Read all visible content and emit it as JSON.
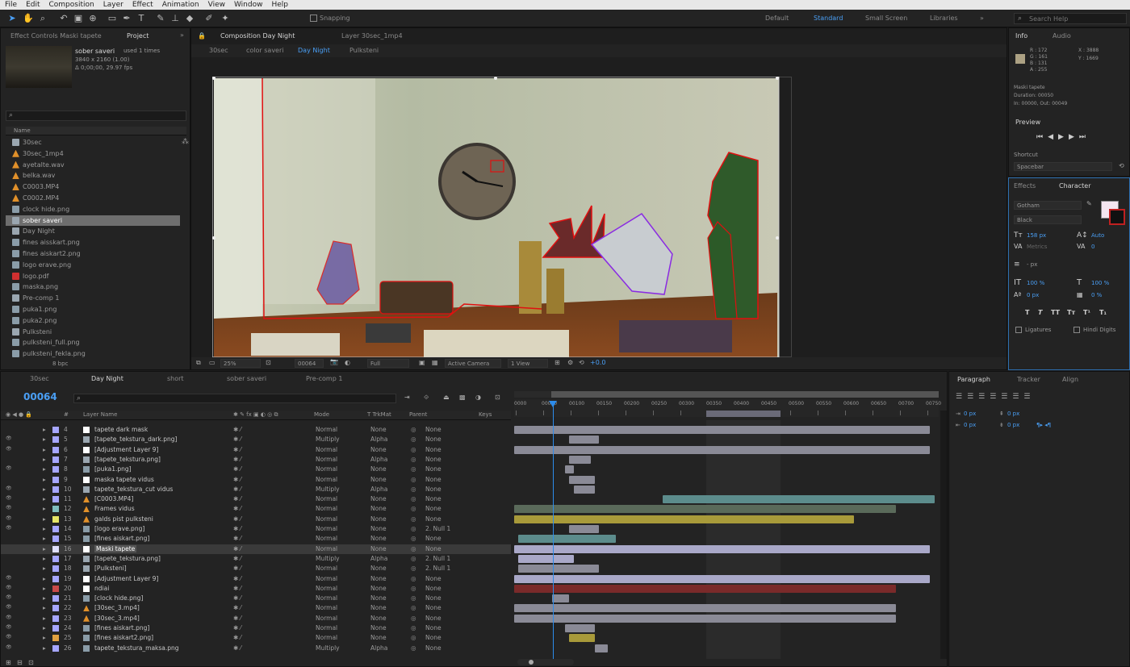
{
  "menu": [
    "File",
    "Edit",
    "Composition",
    "Layer",
    "Effect",
    "Animation",
    "View",
    "Window",
    "Help"
  ],
  "toolbar": {
    "snapping_label": "Snapping",
    "workspaces": [
      "Default",
      "Standard",
      "Small Screen",
      "Libraries"
    ],
    "search_placeholder": "Search Help"
  },
  "project": {
    "tabs": [
      "Effect Controls Maski tapete",
      "Project"
    ],
    "selected_item": {
      "name": "sober saveri",
      "used": "used 1 times",
      "size": "3840 x 2160 (1.00)",
      "duration": "Δ 0;00;00, 29.97 fps"
    },
    "search_placeholder": "",
    "column_header": "Name",
    "items": [
      {
        "name": "30sec",
        "type": "comp"
      },
      {
        "name": "30sec_1mp4",
        "type": "cone"
      },
      {
        "name": "ayetalte.wav",
        "type": "cone"
      },
      {
        "name": "belka.wav",
        "type": "cone"
      },
      {
        "name": "C0003.MP4",
        "type": "cone"
      },
      {
        "name": "C0002.MP4",
        "type": "cone"
      },
      {
        "name": "clock hide.png",
        "type": "img"
      },
      {
        "name": "sober saveri",
        "type": "comp",
        "selected": true
      },
      {
        "name": "Day Night",
        "type": "comp"
      },
      {
        "name": "fines aisskart.png",
        "type": "img"
      },
      {
        "name": "fines aiskart2.png",
        "type": "img"
      },
      {
        "name": "logo erave.png",
        "type": "img"
      },
      {
        "name": "logo.pdf",
        "type": "pdf"
      },
      {
        "name": "maska.png",
        "type": "img"
      },
      {
        "name": "Pre-comp 1",
        "type": "comp"
      },
      {
        "name": "puka1.png",
        "type": "img"
      },
      {
        "name": "puka2.png",
        "type": "img"
      },
      {
        "name": "Pulksteni",
        "type": "comp"
      },
      {
        "name": "pulksteni_full.png",
        "type": "img"
      },
      {
        "name": "pulksteni_fekla.png",
        "type": "img"
      }
    ],
    "footer_bpc": "8 bpc"
  },
  "composition": {
    "tabs": [
      "Composition Day Night",
      "Layer 30sec_1mp4"
    ],
    "breadcrumb": [
      "30sec",
      "color saveri",
      "Day Night",
      "Pulksteni"
    ],
    "zoom": "25%",
    "timecode": "00064",
    "resolution": "Full",
    "camera": "Active Camera",
    "views": "1 View",
    "exposure": "+0.0"
  },
  "info": {
    "tabs": [
      "Info",
      "Audio"
    ],
    "rgba": [
      "R : 172",
      "G : 161",
      "B : 131",
      "A : 255"
    ],
    "xy": [
      "X : 3888",
      "Y : 1669"
    ],
    "layer_name": "Maski tapete",
    "duration": "Duration: 00050",
    "inout": "In: 00000, Out: 00049",
    "preview_label": "Preview",
    "shortcut_label": "Shortcut",
    "shortcut_value": "Spacebar"
  },
  "character": {
    "tabs": [
      "Effects",
      "Character"
    ],
    "font": "Gotham",
    "style": "Black",
    "size": "158 px",
    "leading": "Auto",
    "tracking": "0",
    "kerning": "Metrics",
    "stroke": "- px",
    "vscale": "100 %",
    "hscale": "100 %",
    "baseline": "0 px",
    "tsume": "0 %",
    "ligatures": "Ligatures",
    "hindi": "Hindi Digits",
    "style_buttons": [
      "T",
      "T",
      "TT",
      "Tт",
      "T¹",
      "T₁"
    ]
  },
  "paragraph": {
    "tabs": [
      "Paragraph",
      "Tracker",
      "Align"
    ],
    "indent_values": [
      "0 px",
      "0 px",
      "0 px",
      "0 px",
      "0 px"
    ]
  },
  "timeline": {
    "tabs": [
      "30sec",
      "Day Night",
      "short",
      "sober saveri",
      "Pre-comp 1"
    ],
    "timecode": "00064",
    "search_placeholder": "",
    "headers": {
      "num": "#",
      "name": "Layer Name",
      "mode": "Mode",
      "trkmat": "T TrkMat",
      "parent": "Parent",
      "keys": "Keys"
    },
    "ruler": [
      "0000",
      "00050",
      "00100",
      "00150",
      "00200",
      "00250",
      "00300",
      "00350",
      "00400",
      "00450",
      "00500",
      "00550",
      "00600",
      "00650",
      "00700",
      "00750"
    ],
    "layers": [
      {
        "n": "4",
        "color": "#a6a6ff",
        "icon": "solid",
        "name": "tapete dark mask",
        "mode": "Normal",
        "trk": "None",
        "parent": "None",
        "eye": false
      },
      {
        "n": "5",
        "color": "#a6a6ff",
        "icon": "comp",
        "name": "[tapete_tekstura_dark.png]",
        "mode": "Multiply",
        "trk": "Alpha",
        "parent": "None",
        "eye": true
      },
      {
        "n": "6",
        "color": "#a6a6ff",
        "icon": "solid",
        "name": "[Adjustment Layer 9]",
        "mode": "Normal",
        "trk": "None",
        "parent": "None",
        "eye": true
      },
      {
        "n": "7",
        "color": "#a6a6ff",
        "icon": "comp",
        "name": "[tapete_tekstura.png]",
        "mode": "Normal",
        "trk": "Alpha",
        "parent": "None",
        "eye": false
      },
      {
        "n": "8",
        "color": "#a6a6ff",
        "icon": "img",
        "name": "[puka1.png]",
        "mode": "Normal",
        "trk": "None",
        "parent": "None",
        "eye": true
      },
      {
        "n": "9",
        "color": "#a6a6ff",
        "icon": "solid",
        "name": "maska tapete vidus",
        "mode": "Normal",
        "trk": "None",
        "parent": "None",
        "eye": false
      },
      {
        "n": "10",
        "color": "#a6a6ff",
        "icon": "comp",
        "name": "tapete_tekstura_cut vidus",
        "mode": "Multiply",
        "trk": "Alpha",
        "parent": "None",
        "eye": true
      },
      {
        "n": "11",
        "color": "#a6a6ff",
        "icon": "cone",
        "name": "[C0003.MP4]",
        "mode": "Normal",
        "trk": "None",
        "parent": "None",
        "eye": true
      },
      {
        "n": "12",
        "color": "#7fbdbd",
        "icon": "cone",
        "name": "Frames vidus",
        "mode": "Normal",
        "trk": "None",
        "parent": "None",
        "eye": true
      },
      {
        "n": "13",
        "color": "#e5e566",
        "icon": "cone",
        "name": "galds pist pulksteni",
        "mode": "Normal",
        "trk": "None",
        "parent": "None",
        "eye": true
      },
      {
        "n": "14",
        "color": "#a6a6ff",
        "icon": "img",
        "name": "[logo erave.png]",
        "mode": "Normal",
        "trk": "None",
        "parent": "2. Null 1",
        "eye": true
      },
      {
        "n": "15",
        "color": "#a6a6ff",
        "icon": "img",
        "name": "[fines aiskart.png]",
        "mode": "Normal",
        "trk": "None",
        "parent": "None",
        "eye": false
      },
      {
        "n": "16",
        "color": "#e0e0ff",
        "icon": "solid",
        "name": "Maski tapete",
        "mode": "Normal",
        "trk": "None",
        "parent": "None",
        "eye": false,
        "selected": true
      },
      {
        "n": "17",
        "color": "#a6a6ff",
        "icon": "comp",
        "name": "[tapete_tekstura.png]",
        "mode": "Multiply",
        "trk": "Alpha",
        "parent": "2. Null 1",
        "eye": false
      },
      {
        "n": "18",
        "color": "#a6a6ff",
        "icon": "comp",
        "name": "[Pulksteni]",
        "mode": "Normal",
        "trk": "None",
        "parent": "2. Null 1",
        "eye": false
      },
      {
        "n": "19",
        "color": "#a6a6ff",
        "icon": "solid",
        "name": "[Adjustment Layer 9]",
        "mode": "Normal",
        "trk": "None",
        "parent": "None",
        "eye": true
      },
      {
        "n": "20",
        "color": "#c84a4a",
        "icon": "solid",
        "name": "ndiai",
        "mode": "Normal",
        "trk": "None",
        "parent": "None",
        "eye": true
      },
      {
        "n": "21",
        "color": "#a6a6ff",
        "icon": "img",
        "name": "[clock hide.png]",
        "mode": "Normal",
        "trk": "None",
        "parent": "None",
        "eye": true
      },
      {
        "n": "22",
        "color": "#a6a6ff",
        "icon": "cone",
        "name": "[30sec_3.mp4]",
        "mode": "Normal",
        "trk": "None",
        "parent": "None",
        "eye": true
      },
      {
        "n": "23",
        "color": "#a6a6ff",
        "icon": "cone",
        "name": "[30sec_3.mp4]",
        "mode": "Normal",
        "trk": "None",
        "parent": "None",
        "eye": true
      },
      {
        "n": "24",
        "color": "#a6a6ff",
        "icon": "img",
        "name": "[fines aiskart.png]",
        "mode": "Normal",
        "trk": "None",
        "parent": "None",
        "eye": true
      },
      {
        "n": "25",
        "color": "#e0a040",
        "icon": "img",
        "name": "[fines aiskart2.png]",
        "mode": "Normal",
        "trk": "None",
        "parent": "None",
        "eye": true
      },
      {
        "n": "26",
        "color": "#a6a6ff",
        "icon": "img",
        "name": "tapete_tekstura_maksa.png",
        "mode": "Multiply",
        "trk": "Alpha",
        "parent": "None",
        "eye": true
      }
    ],
    "colors": {
      "accent": "#2d8ceb",
      "track": "#8a8a96",
      "lavender": "#a9a8c8",
      "teal": "#5c8c8c",
      "yellow": "#a89a3a",
      "red": "#7a2a2a",
      "mask_red": "#e01010",
      "mask_purple": "#8a2be2"
    }
  }
}
